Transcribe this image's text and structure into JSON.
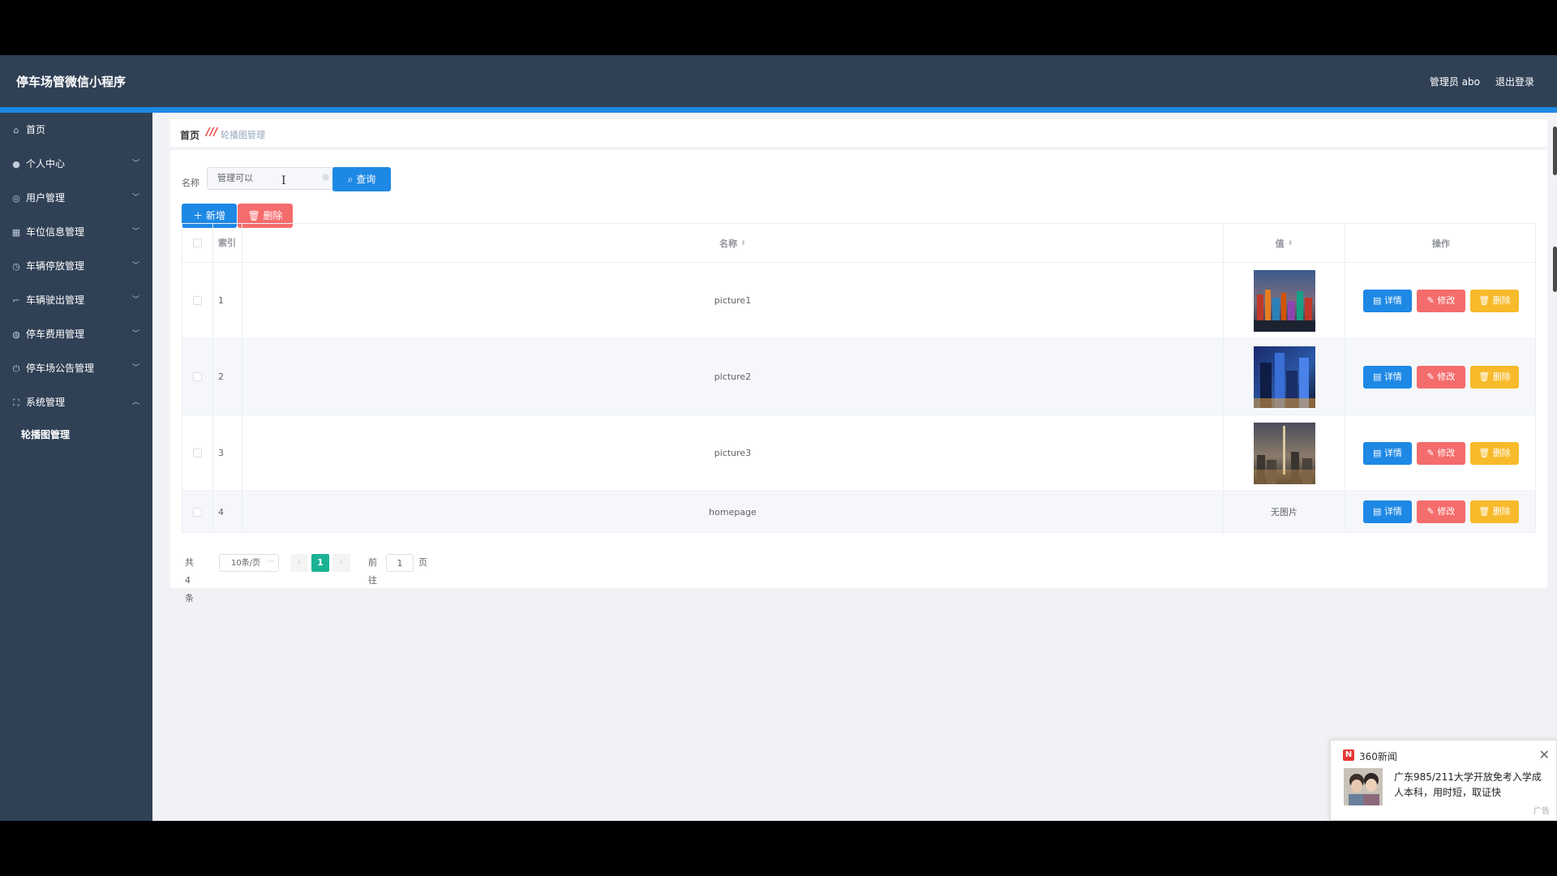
{
  "app": {
    "title": "停车场管微信小程序",
    "user_label": "管理员 abo",
    "logout_label": "退出登录"
  },
  "sidebar": {
    "items": [
      {
        "label": "首页",
        "icon": "home-icon",
        "glyph": "⌂",
        "expandable": false
      },
      {
        "label": "个人中心",
        "icon": "user-icon",
        "glyph": "●",
        "expandable": true
      },
      {
        "label": "用户管理",
        "icon": "users-icon",
        "glyph": "◎",
        "expandable": true
      },
      {
        "label": "车位信息管理",
        "icon": "table-icon",
        "glyph": "▦",
        "expandable": true
      },
      {
        "label": "车辆停放管理",
        "icon": "clock-icon",
        "glyph": "◷",
        "expandable": true
      },
      {
        "label": "车辆驶出管理",
        "icon": "crop-icon",
        "glyph": "⌐",
        "expandable": true
      },
      {
        "label": "停车费用管理",
        "icon": "help-icon",
        "glyph": "◍",
        "expandable": true
      },
      {
        "label": "停车场公告管理",
        "icon": "power-icon",
        "glyph": "⏻",
        "expandable": true
      },
      {
        "label": "系统管理",
        "icon": "full-screen-icon",
        "glyph": "⛶",
        "expandable": true,
        "expanded": true
      }
    ],
    "submenu": [
      {
        "label": "轮播图管理"
      }
    ]
  },
  "breadcrumb": {
    "home": "首页",
    "separator": "///",
    "current": "轮播图管理"
  },
  "search": {
    "label": "名称",
    "value": "管理可以",
    "query_button": "查询",
    "query_icon": "search-icon"
  },
  "actions": {
    "add_label": "新增",
    "delete_label": "删除"
  },
  "table": {
    "headers": {
      "index": "索引",
      "name": "名称",
      "value": "值",
      "ops": "操作"
    },
    "rows": [
      {
        "index": "1",
        "name": "picture1",
        "has_image": true,
        "image_kind": "city-bridge"
      },
      {
        "index": "2",
        "name": "picture2",
        "has_image": true,
        "image_kind": "city-night-blue"
      },
      {
        "index": "3",
        "name": "picture3",
        "has_image": true,
        "image_kind": "city-sunset"
      },
      {
        "index": "4",
        "name": "homepage",
        "has_image": false,
        "no_image_text": "无图片"
      }
    ],
    "row_buttons": {
      "detail": "详情",
      "edit": "修改",
      "delete": "删除"
    }
  },
  "pagination": {
    "total": "共 4 条",
    "page_size": "10条/页",
    "current_page": "1",
    "goto_label": "前往",
    "goto_value": "1",
    "page_unit": "页"
  },
  "ad": {
    "source": "360新闻",
    "logo_letter": "N",
    "text": "广东985/211大学开放免考入学成人本科，用时短，取证快",
    "tag": "广告"
  },
  "colors": {
    "header_bg": "#304156",
    "accent": "#1e88e5",
    "danger": "#f56c6c",
    "warning": "#f7ba2a",
    "pager_active": "#19b394"
  }
}
